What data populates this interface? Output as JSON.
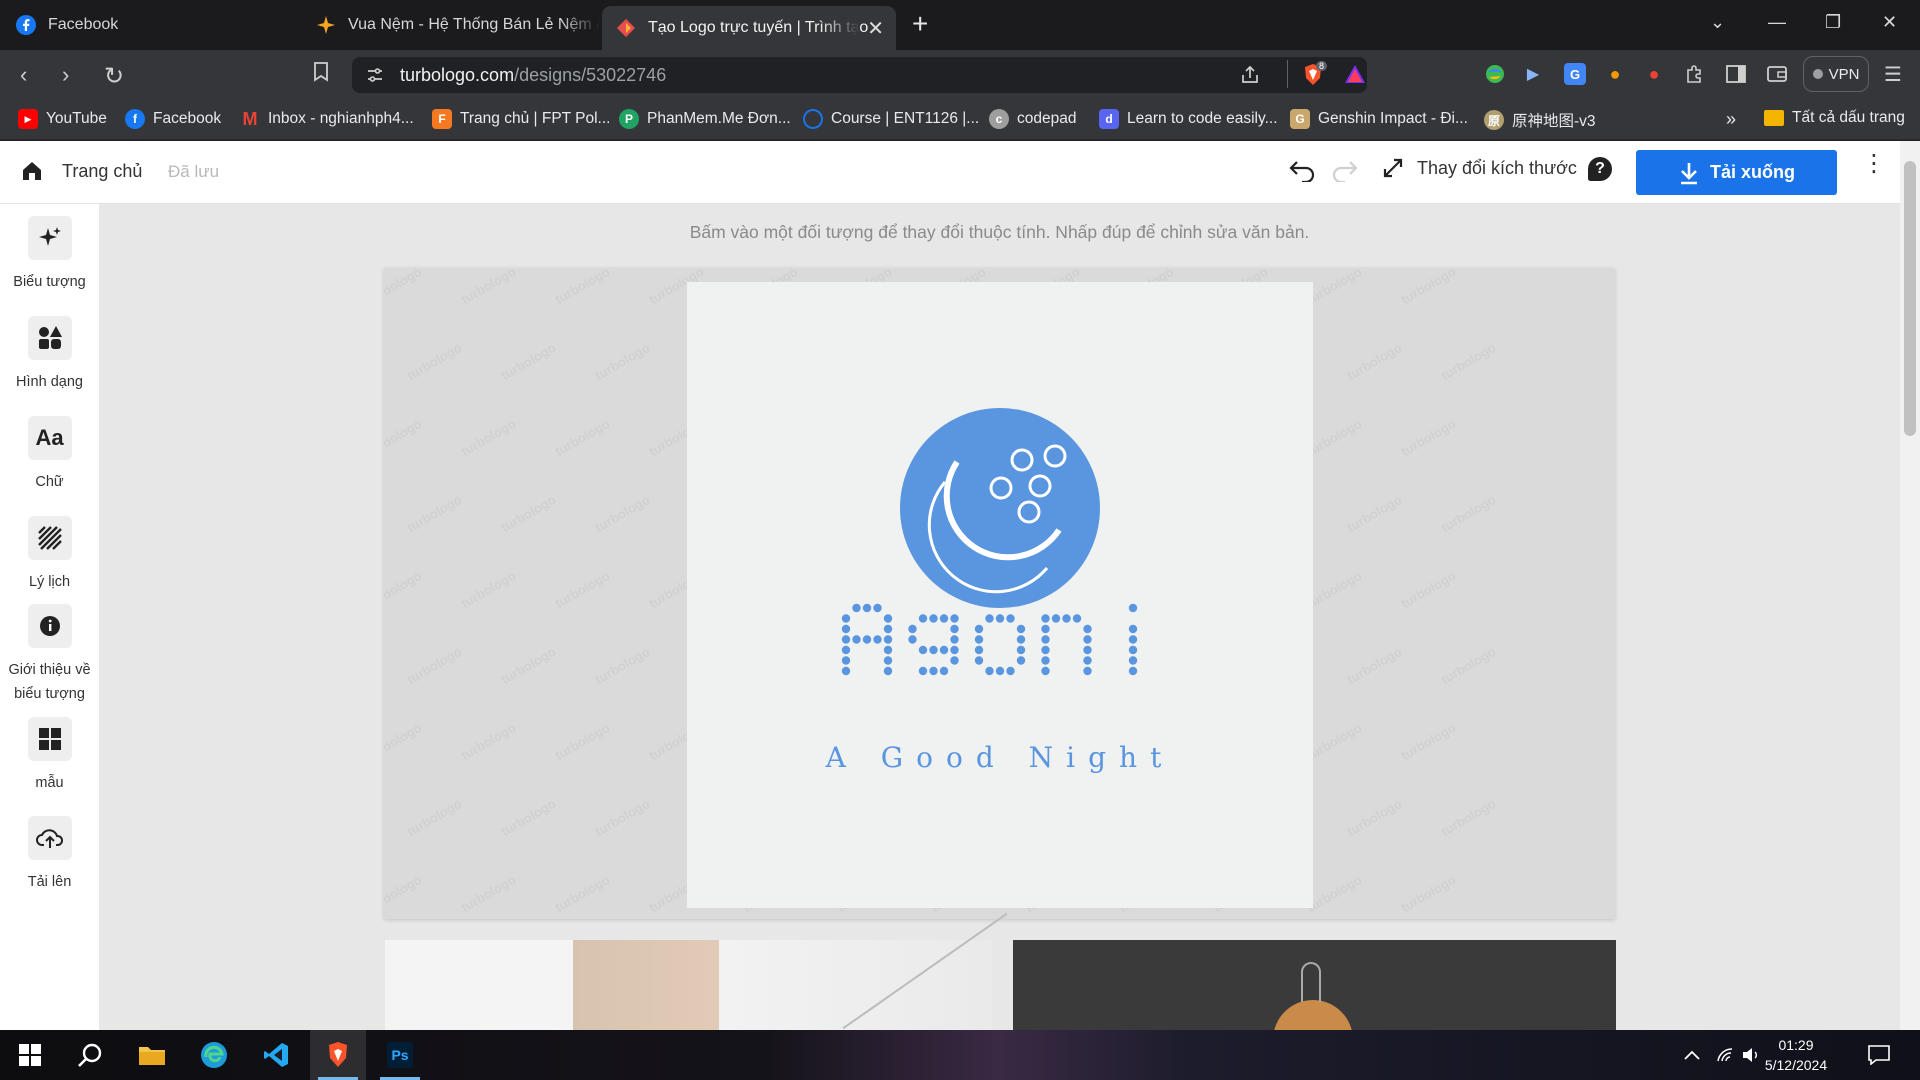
{
  "browser": {
    "tabs": [
      {
        "title": "Facebook",
        "icon": "facebook-icon",
        "active": false
      },
      {
        "title": "Vua Nệm - Hệ Thống Bán Lẻ Nệm &",
        "icon": "sparkle-icon",
        "active": false
      },
      {
        "title": "Tạo Logo trực tuyến | Trình tạo",
        "icon": "turbologo-icon",
        "active": true
      }
    ],
    "url_host": "turbologo.com",
    "url_path": "/designs/53022746",
    "shields_count": "8",
    "vpn_label": "VPN",
    "bookmarks": [
      {
        "label": "YouTube",
        "icon": "youtube-icon",
        "color": "#ff0000"
      },
      {
        "label": "Facebook",
        "icon": "facebook-icon",
        "color": "#1877f2"
      },
      {
        "label": "Inbox - nghianhph4...",
        "icon": "gmail-icon",
        "color": "#ea4335"
      },
      {
        "label": "Trang chủ | FPT Pol...",
        "icon": "fpt-icon",
        "color": "#f47920"
      },
      {
        "label": "PhanMem.Me Đơn...",
        "icon": "phanmem-icon",
        "color": "#1fa463"
      },
      {
        "label": "Course | ENT1126 |...",
        "icon": "course-icon",
        "color": "#1a73e8"
      },
      {
        "label": "codepad",
        "icon": "codepad-icon",
        "color": "#9e9e9e"
      },
      {
        "label": "Learn to code easily...",
        "icon": "discord-icon",
        "color": "#5865f2"
      },
      {
        "label": "Genshin Impact - Đi...",
        "icon": "genshin-icon",
        "color": "#c9a66b"
      },
      {
        "label": "原神地图-v3",
        "icon": "map-icon",
        "color": "#b0a070"
      }
    ],
    "bookmarks_overflow": "»",
    "all_bookmarks": "Tất cả dấu trang"
  },
  "app": {
    "home_label": "Trang chủ",
    "saved_label": "Đã lưu",
    "resize_label": "Thay đổi kích thước",
    "download_label": "Tải xuống",
    "accent": "#1a73e8"
  },
  "tools": [
    {
      "label": "Biểu tượng",
      "icon": "sparkle-icon"
    },
    {
      "label": "Hình dạng",
      "icon": "shapes-icon"
    },
    {
      "label": "Chữ",
      "icon": "text-icon"
    },
    {
      "label": "Lý lịch",
      "icon": "background-icon"
    },
    {
      "label": "Giới thiệu về biểu tượng",
      "icon": "info-icon"
    },
    {
      "label": "mẫu",
      "icon": "templates-icon"
    },
    {
      "label": "Tải lên",
      "icon": "upload-icon"
    }
  ],
  "canvas": {
    "hint": "Bấm vào một đối tượng để thay đổi thuộc tính. Nhấp đúp để chỉnh sửa văn bản.",
    "watermark": "turbologo",
    "logo_name": "Agoni",
    "logo_tagline": "A Good Night",
    "logo_color": "#5a96e0"
  },
  "taskbar": {
    "time": "01:29",
    "date": "5/12/2024"
  }
}
